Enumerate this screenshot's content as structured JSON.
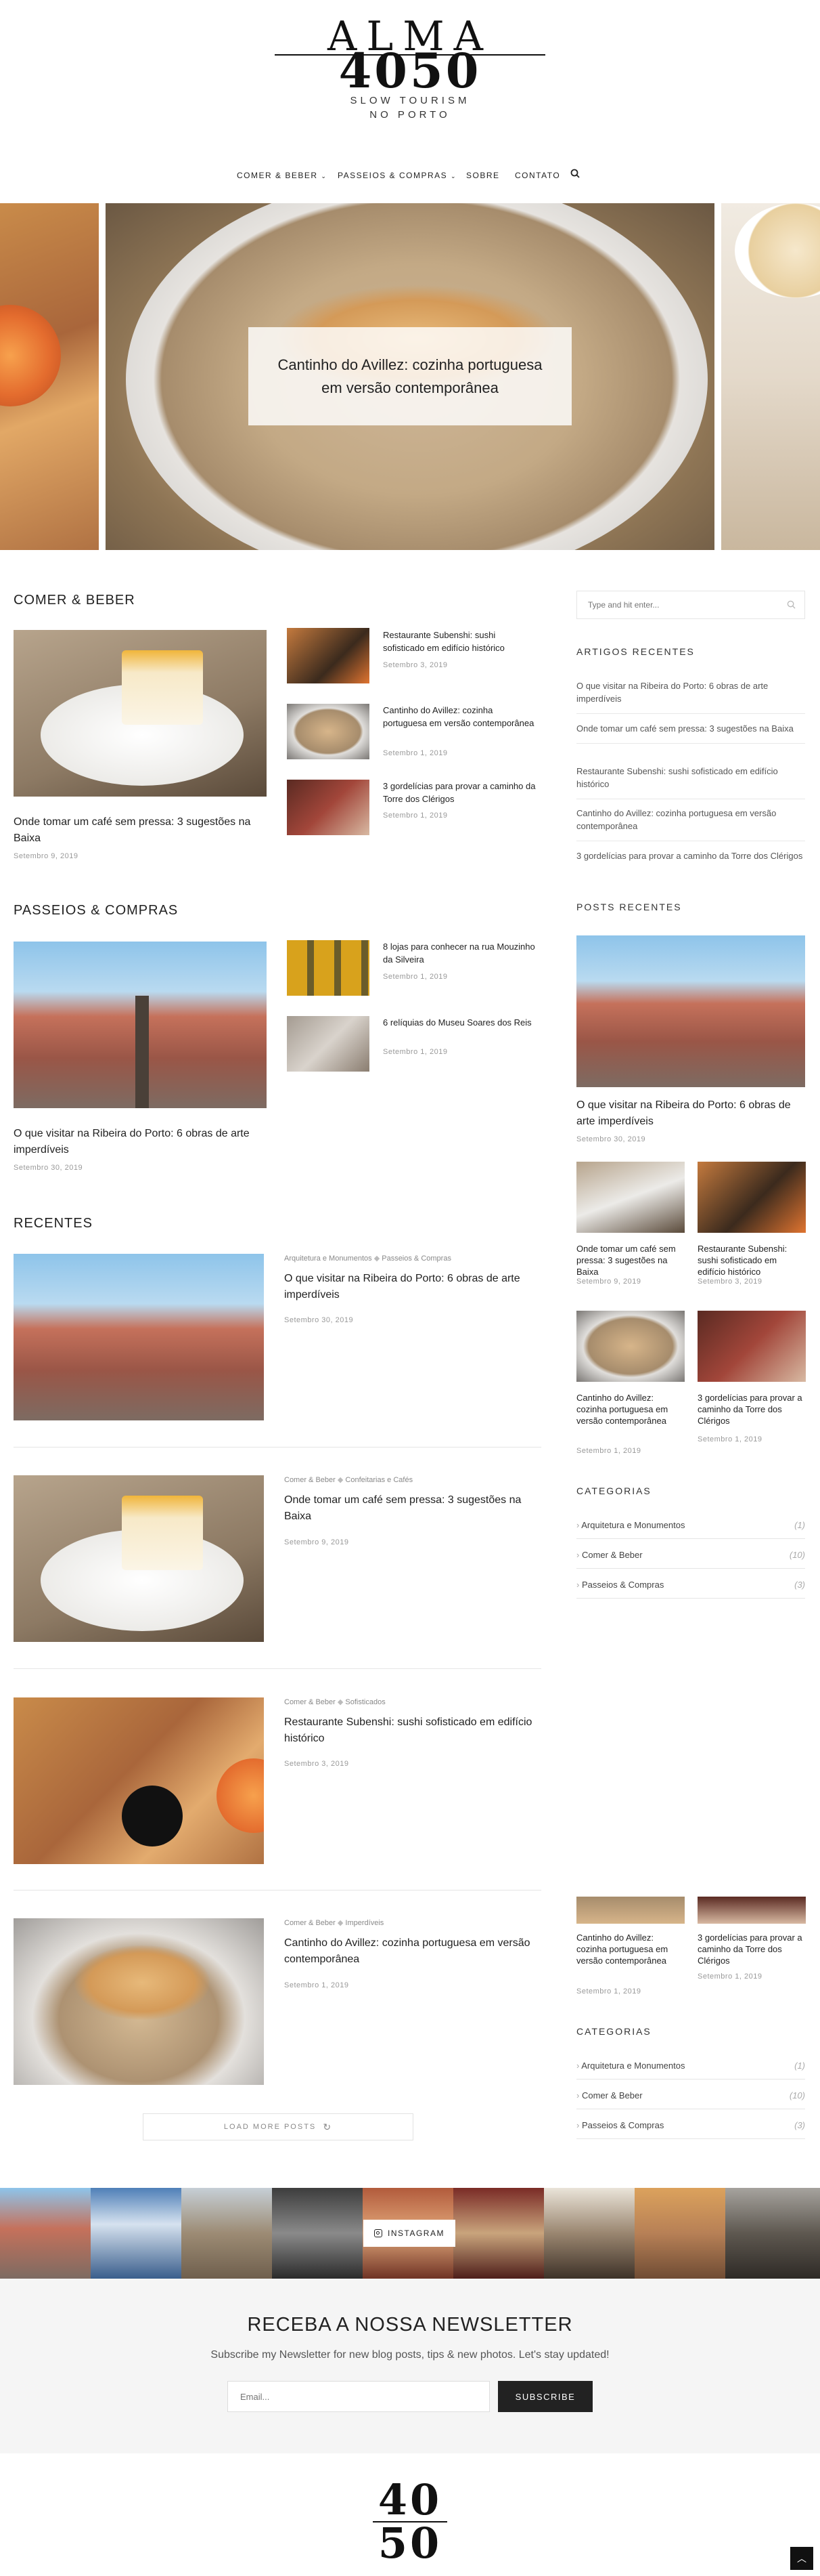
{
  "header": {
    "logo_word": "ALMA",
    "logo_number": "4050",
    "tagline_1": "SLOW TOURISM",
    "tagline_2": "NO PORTO"
  },
  "nav": {
    "items": [
      "Comer & Beber",
      "Passeios & Compras",
      "Sobre",
      "Contato"
    ],
    "search_icon": "search-icon"
  },
  "hero": {
    "title": "Cantinho do Avillez: cozinha portuguesa em versão contemporânea"
  },
  "comer": {
    "section_title": "Comer & Beber",
    "main": {
      "title": "Onde tomar um café sem pressa: 3 sugestões na Baixa",
      "date": "Setembro 9, 2019"
    },
    "list": [
      {
        "title": "Restaurante Subenshi: sushi sofisticado em edifício histórico",
        "date": "Setembro 3, 2019"
      },
      {
        "title": "Cantinho do Avillez: cozinha portuguesa em versão contemporânea",
        "date": "Setembro 1, 2019"
      },
      {
        "title": "3 gordelícias para provar a caminho da Torre dos Clérigos",
        "date": "Setembro 1, 2019"
      }
    ]
  },
  "passeios": {
    "section_title": "Passeios & Compras",
    "main": {
      "title": "O que visitar na Ribeira do Porto: 6 obras de arte imperdíveis",
      "date": "Setembro 30, 2019"
    },
    "list": [
      {
        "title": "8 lojas para conhecer na rua Mouzinho da Silveira",
        "date": "Setembro 1, 2019"
      },
      {
        "title": "6 relíquias do Museu Soares dos Reis",
        "date": "Setembro 1, 2019"
      }
    ]
  },
  "recentes": {
    "section_title": "Recentes",
    "posts": [
      {
        "cat1": "Arquitetura e Monumentos",
        "cat2": "Passeios & Compras",
        "title": "O que visitar na Ribeira do Porto: 6 obras de arte imperdíveis",
        "date": "Setembro 30, 2019"
      },
      {
        "cat1": "Comer & Beber",
        "cat2": "Confeitarias e Cafés",
        "title": "Onde tomar um café sem pressa: 3 sugestões na Baixa",
        "date": "Setembro 9, 2019"
      },
      {
        "cat1": "Comer & Beber",
        "cat2": "Sofisticados",
        "title": "Restaurante Subenshi: sushi sofisticado em edifício histórico",
        "date": "Setembro 3, 2019"
      },
      {
        "cat1": "Comer & Beber",
        "cat2": "Imperdíveis",
        "title": "Cantinho do Avillez: cozinha portuguesa em versão contemporânea",
        "date": "Setembro 1, 2019"
      }
    ],
    "load_more": "LOAD MORE POSTS"
  },
  "sidebar": {
    "search_placeholder": "Type and hit enter...",
    "artigos_title": "Artigos Recentes",
    "artigos": [
      "O que visitar na Ribeira do Porto: 6 obras de arte imperdíveis",
      "Onde tomar um café sem pressa: 3 sugestões na Baixa",
      "Restaurante Subenshi: sushi sofisticado em edifício histórico",
      "Cantinho do Avillez: cozinha portuguesa em versão contemporânea",
      "3 gordelícias para provar a caminho da Torre dos Clérigos"
    ],
    "posts_title": "Posts Recentes",
    "posts_main": {
      "title": "O que visitar na Ribeira do Porto: 6 obras de arte imperdíveis",
      "date": "Setembro 30, 2019"
    },
    "posts_grid": [
      {
        "title": "Onde tomar um café sem pressa: 3 sugestões na Baixa",
        "date": "Setembro 9, 2019"
      },
      {
        "title": "Restaurante Subenshi: sushi sofisticado em edifício histórico",
        "date": "Setembro 3, 2019"
      },
      {
        "title": "Cantinho do Avillez: cozinha portuguesa em versão contemporânea",
        "date": "Setembro 1, 2019"
      },
      {
        "title": "3 gordelícias para provar a caminho da Torre dos Clérigos",
        "date": "Setembro 1, 2019"
      }
    ],
    "categorias_title": "Categorias",
    "categorias": [
      {
        "name": "Arquitetura e Monumentos",
        "count": "(1)"
      },
      {
        "name": "Comer & Beber",
        "count": "(10)"
      },
      {
        "name": "Passeios & Compras",
        "count": "(3)"
      }
    ],
    "sticky": [
      {
        "title": "Cantinho do Avillez: cozinha portuguesa em versão contemporânea",
        "date": "Setembro 1, 2019"
      },
      {
        "title": "3 gordelícias para provar a caminho da Torre dos Clérigos",
        "date": "Setembro 1, 2019"
      }
    ]
  },
  "instagram": {
    "label": "INSTAGRAM"
  },
  "newsletter": {
    "title": "RECEBA A NOSSA NEWSLETTER",
    "subtitle": "Subscribe my Newsletter for new blog posts, tips & new photos. Let's stay updated!",
    "email_placeholder": "Email...",
    "button": "SUBSCRIBE"
  },
  "footer": {
    "logo_top": "40",
    "logo_bottom": "50"
  }
}
